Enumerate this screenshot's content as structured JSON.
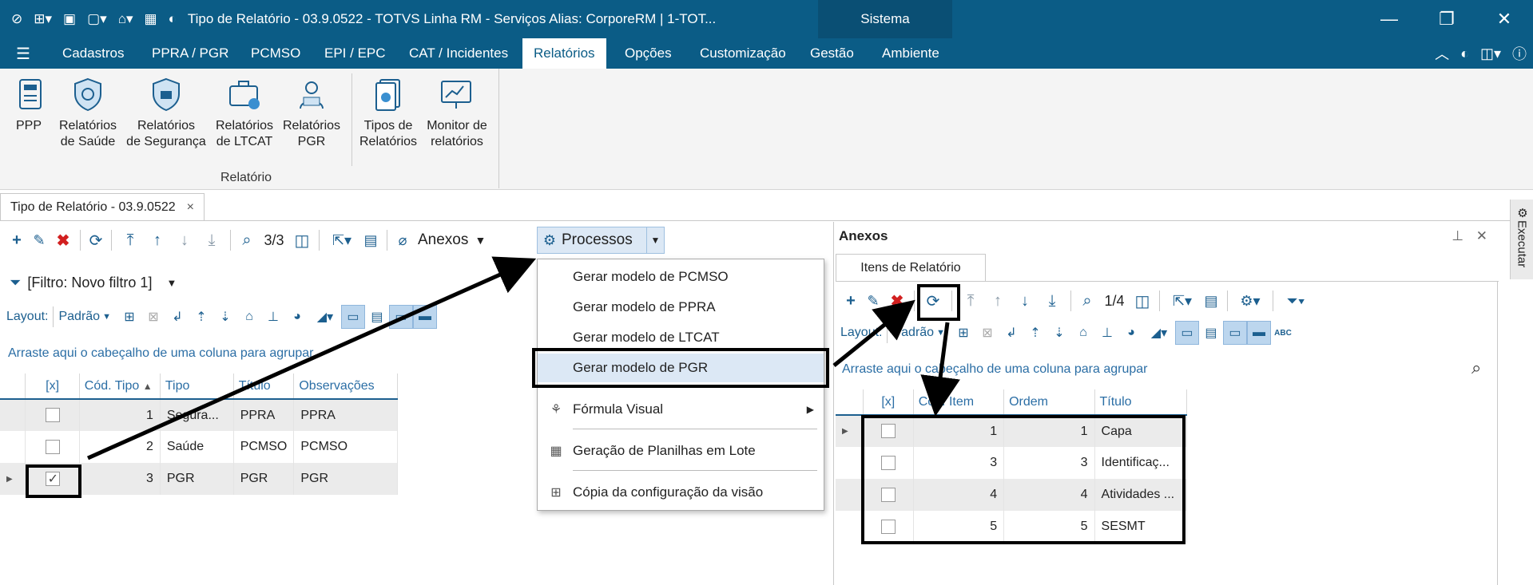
{
  "window": {
    "title": "Tipo de Relatório - 03.9.0522 - TOTVS Linha RM - Serviços  Alias: CorporeRM | 1-TOT...",
    "sistema": "Sistema"
  },
  "menu": {
    "items": [
      "Cadastros",
      "PPRA / PGR",
      "PCMSO",
      "EPI / EPC",
      "CAT / Incidentes",
      "Relatórios",
      "Opções",
      "Customização",
      "Gestão",
      "Ambiente"
    ],
    "active": "Relatórios"
  },
  "ribbon": {
    "buttons": [
      {
        "l1": "PPP",
        "l2": ""
      },
      {
        "l1": "Relatórios",
        "l2": "de Saúde"
      },
      {
        "l1": "Relatórios",
        "l2": "de Segurança"
      },
      {
        "l1": "Relatórios",
        "l2": "de LTCAT"
      },
      {
        "l1": "Relatórios",
        "l2": "PGR"
      },
      {
        "l1": "Tipos de",
        "l2": "Relatórios"
      },
      {
        "l1": "Monitor de",
        "l2": "relatórios"
      }
    ],
    "group_label": "Relatório"
  },
  "doc_tab": {
    "label": "Tipo de Relatório - 03.9.0522",
    "close": "×"
  },
  "left": {
    "record_counter": "3/3",
    "anexos_label": "Anexos",
    "processos_label": "Processos",
    "filter_label": "[Filtro: Novo filtro 1]",
    "layout_label": "Layout:",
    "layout_value": "Padrão",
    "group_hint": "Arraste aqui o cabeçalho de uma coluna para agrupar",
    "columns": [
      "[x]",
      "Cód. Tipo",
      "Tipo",
      "Título",
      "Observações"
    ],
    "rows": [
      {
        "checked": false,
        "cod": "1",
        "tipo": "Segura...",
        "titulo": "PPRA",
        "obs": "PPRA"
      },
      {
        "checked": false,
        "cod": "2",
        "tipo": "Saúde",
        "titulo": "PCMSO",
        "obs": "PCMSO"
      },
      {
        "checked": true,
        "cod": "3",
        "tipo": "PGR",
        "titulo": "PGR",
        "obs": "PGR"
      }
    ]
  },
  "processos_menu": {
    "items": [
      "Gerar modelo de PCMSO",
      "Gerar modelo de PPRA",
      "Gerar modelo de LTCAT",
      "Gerar modelo de PGR",
      "Fórmula Visual",
      "Geração de Planilhas em Lote",
      "Cópia da configuração da visão"
    ],
    "highlighted": "Gerar modelo de PGR"
  },
  "anexos": {
    "title": "Anexos",
    "tab": "Itens de Relatório",
    "record_counter": "1/4",
    "layout_label": "Layout:",
    "layout_value": "Padrão",
    "group_hint": "Arraste aqui o cabeçalho de uma coluna para agrupar",
    "columns": [
      "[x]",
      "Cód. Item",
      "Ordem",
      "Título"
    ],
    "rows": [
      {
        "cod": "1",
        "ordem": "1",
        "titulo": "Capa"
      },
      {
        "cod": "3",
        "ordem": "3",
        "titulo": "Identificaç..."
      },
      {
        "cod": "4",
        "ordem": "4",
        "titulo": "Atividades ..."
      },
      {
        "cod": "5",
        "ordem": "5",
        "titulo": "SESMT"
      }
    ]
  },
  "side_panel": {
    "label": "Executar"
  },
  "colors": {
    "title_bg": "#0b5c86",
    "accent": "#1c5f8f",
    "delete": "#d22020",
    "highlight": "#dce8f5"
  }
}
